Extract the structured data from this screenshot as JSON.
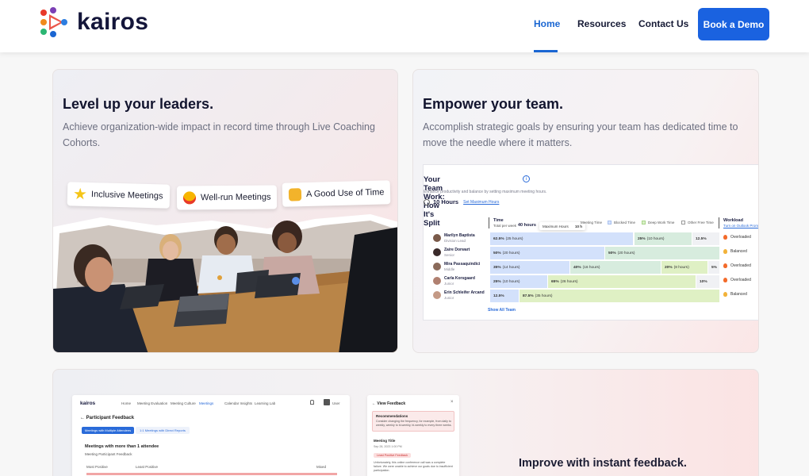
{
  "header": {
    "brand": "kairos",
    "nav": [
      {
        "label": "Home"
      },
      {
        "label": "Resources"
      },
      {
        "label": "Contact Us"
      }
    ],
    "cta": "Book a Demo",
    "colors": {
      "accent": "#1a66d2",
      "button": "#1a62e0"
    }
  },
  "card1": {
    "title": "Level up your leaders.",
    "desc": "Achieve organization-wide impact in record time through Live Coaching Cohorts.",
    "pills": [
      {
        "icon": "star-icon",
        "label": "Inclusive Meetings"
      },
      {
        "icon": "heart-eyes-icon",
        "label": "Well-run Meetings"
      },
      {
        "icon": "thumbs-up-icon",
        "label": "A Good Use of Time"
      }
    ]
  },
  "card2": {
    "title": "Empower your team.",
    "desc": "Accomplish strategic goals by ensuring your team has dedicated time to move the needle where it matters.",
    "panel": {
      "title": "Your Team Work: How It's Split",
      "subtitle": "Enhance productivity and balance by setting maximum meeting hours.",
      "hours": "10 Hours",
      "set_link": "Set Maximum Hours",
      "time_header": "Time",
      "time_sub": "Total per week",
      "hours_chip": "40 hours",
      "tooltip_label": "Maximum Hours",
      "tooltip_value": "10 h",
      "legend": [
        "Meeting Time",
        "Blocked Time",
        "Deep Work Time",
        "Other Free Time"
      ],
      "workload_header": "Workload",
      "workload_link": "Turn on Outlook Prom",
      "rows": [
        {
          "name": "Marilyn Baptista",
          "role": "Division Lead",
          "segments": [
            {
              "pct": "62.5%",
              "hrs": "(25 hours)"
            },
            {
              "pct": "25%",
              "hrs": "(10 hours)"
            },
            {
              "pct": "12.5%",
              "hrs": "(5 hours)"
            }
          ],
          "workload": "Overloaded"
        },
        {
          "name": "Zaire Dorwart",
          "role": "Senior",
          "segments": [
            {
              "pct": "50%",
              "hrs": "(20 hours)"
            },
            {
              "pct": "50%",
              "hrs": "(20 hours)"
            }
          ],
          "workload": "Balanced"
        },
        {
          "name": "Mira Passaquindici",
          "role": "Middle",
          "segments": [
            {
              "pct": "35%",
              "hrs": "(14 hours)"
            },
            {
              "pct": "40%",
              "hrs": "(16 hours)"
            },
            {
              "pct": "20%",
              "hrs": "(8 hours)"
            },
            {
              "pct": "5%",
              "hrs": ""
            }
          ],
          "workload": "Overloaded"
        },
        {
          "name": "Carla Korsgaard",
          "role": "Junior",
          "segments": [
            {
              "pct": "25%",
              "hrs": "(10 hours)"
            },
            {
              "pct": "65%",
              "hrs": "(26 hours)"
            },
            {
              "pct": "10%",
              "hrs": "(4 hours)"
            }
          ],
          "workload": "Overloaded"
        },
        {
          "name": "Erin Schleifer Arcand",
          "role": "Junior",
          "segments": [
            {
              "pct": "12.5%",
              "hrs": ""
            },
            {
              "pct": "87.5%",
              "hrs": "(35 hours)"
            }
          ],
          "workload": "Balanced"
        }
      ],
      "show_all": "Show All Team"
    }
  },
  "card3": {
    "heading": "Improve with instant feedback.",
    "mock": {
      "brand": "kairos",
      "nav": [
        "Home",
        "Meeting Evaluation",
        "Meeting Culture",
        "Meetings",
        "Calendar Insights",
        "Learning Lab"
      ],
      "user": "User",
      "page_title": "Participant Feedback",
      "tabs": [
        "Meetings with Multiple Attendees",
        "1:1 Meetings with Direct Reports"
      ],
      "section_title": "Meetings with more than 1 attendee",
      "section_sub": "Meeting Participant Feedback",
      "cols": [
        "Most Positive",
        "Least Positive",
        "Mixed"
      ],
      "side_title": "View Feedback",
      "rec_title": "Recommendations",
      "rec_text": "Consider changing the frequency, for example, from daily to weekly, weekly to bi-weekly, bi-weekly to every three weeks.",
      "meeting_label": "Meeting Title",
      "meeting_date": "Sep 28, 2023 1:00 PM",
      "feedback_badge": "Least Positive Feedback",
      "feedback_text": "Unfortunately, this online conference call was a complete failure. We were unable to achieve our goals due to insufficient participation."
    }
  }
}
